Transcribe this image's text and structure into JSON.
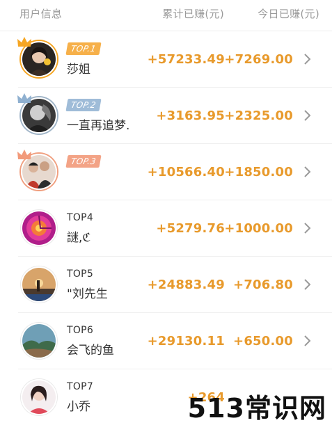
{
  "header": {
    "col_user": "用户信息",
    "col_total": "累计已赚(元)",
    "col_today": "今日已赚(元)"
  },
  "rows": [
    {
      "rank": "TOP.1",
      "rank_style": "badge",
      "name": "莎姐",
      "total": "+57233.49",
      "today": "+7269.00",
      "avatar_icon": "woman-portrait-avatar",
      "crown": "gold"
    },
    {
      "rank": "TOP.2",
      "rank_style": "badge",
      "name": "一直再追梦.",
      "total": "+3163.95",
      "today": "+2325.00",
      "avatar_icon": "man-portrait-avatar",
      "crown": "silver"
    },
    {
      "rank": "TOP.3",
      "rank_style": "badge",
      "name": "",
      "total": "+10566.40",
      "today": "+1850.00",
      "avatar_icon": "couple-photo-avatar",
      "crown": "bronze"
    },
    {
      "rank": "TOP4",
      "rank_style": "plain",
      "name": "謎,ℭ",
      "total": "+5279.76",
      "today": "+1000.00",
      "avatar_icon": "pink-swirl-avatar",
      "crown": ""
    },
    {
      "rank": "TOP5",
      "rank_style": "plain",
      "name": "\"刘先生",
      "total": "+24883.49",
      "today": "+706.80",
      "avatar_icon": "sunset-silhouette-avatar",
      "crown": ""
    },
    {
      "rank": "TOP6",
      "rank_style": "plain",
      "name": "会飞的鱼",
      "total": "+29130.11",
      "today": "+650.00",
      "avatar_icon": "landscape-avatar",
      "crown": ""
    },
    {
      "rank": "TOP7",
      "rank_style": "plain",
      "name": "小乔",
      "total": "+264",
      "today": "",
      "avatar_icon": "girl-portrait-avatar",
      "crown": ""
    }
  ],
  "watermark": "513常识网",
  "colors": {
    "amount": "#e89a2c",
    "gold": "#f6b04a",
    "silver": "#9fbcd8",
    "bronze": "#f3a386"
  }
}
